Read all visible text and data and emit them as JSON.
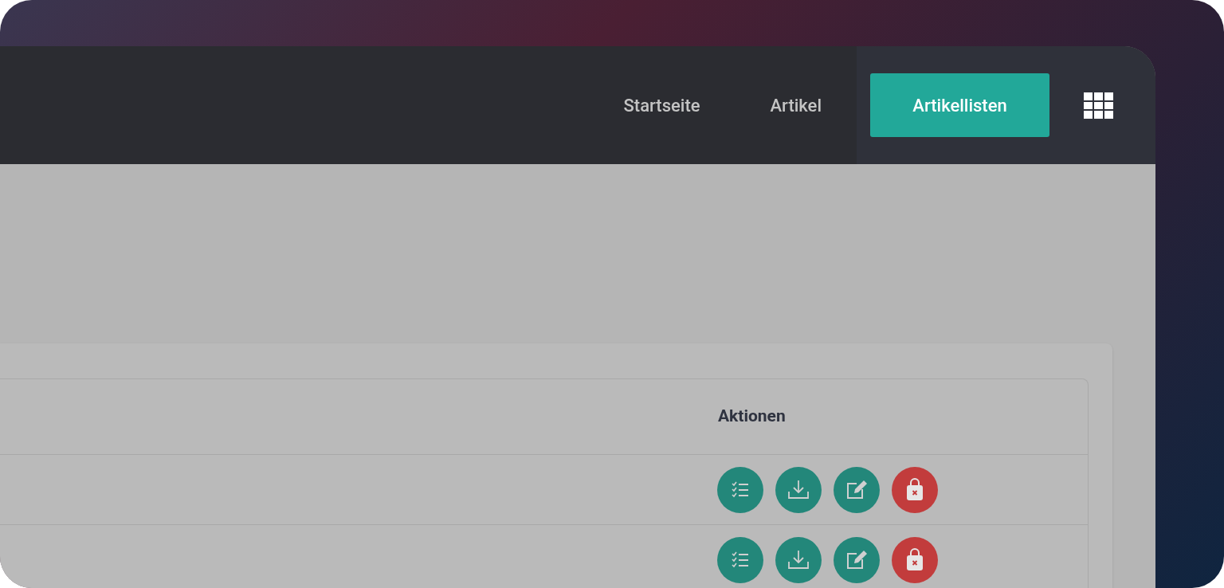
{
  "nav": {
    "items": [
      {
        "label": "Startseite",
        "selected": false
      },
      {
        "label": "Artikel",
        "selected": false
      },
      {
        "label": "Artikellisten",
        "selected": true
      }
    ]
  },
  "table": {
    "columns": [
      "Aktionen"
    ],
    "rows": [
      {
        "actions": [
          {
            "kind": "list"
          },
          {
            "kind": "download"
          },
          {
            "kind": "edit"
          },
          {
            "kind": "delete"
          }
        ]
      },
      {
        "actions": [
          {
            "kind": "list"
          },
          {
            "kind": "download"
          },
          {
            "kind": "edit"
          },
          {
            "kind": "delete"
          }
        ]
      }
    ]
  }
}
